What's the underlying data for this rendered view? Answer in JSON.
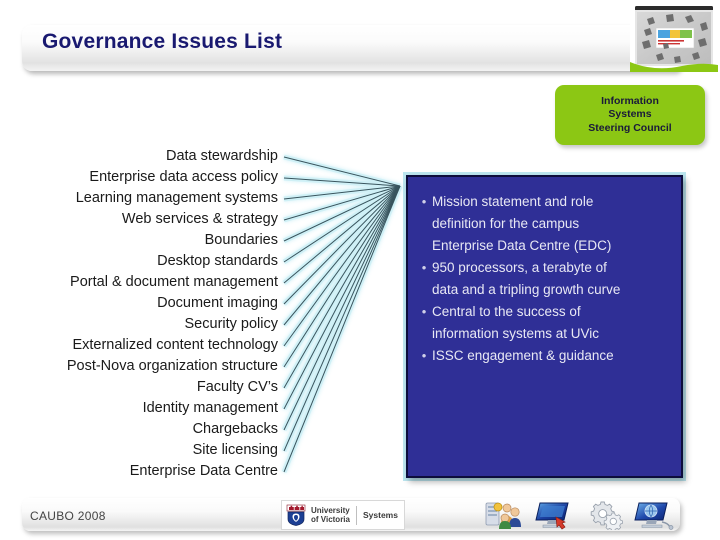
{
  "slide": {
    "title": "Governance Issues List",
    "accent_blue": "#191970",
    "accent_green": "#8cc714",
    "box_blue": "#2f2f96"
  },
  "green_label": {
    "text": "Information\nSystems\nSteering Council",
    "name": "information-systems-steering-council"
  },
  "issues": {
    "items": [
      "Data stewardship",
      "Enterprise data access policy",
      "Learning management systems",
      "Web services & strategy",
      "Boundaries",
      "Desktop standards",
      "Portal & document management",
      "Document imaging",
      "Security policy",
      "Externalized content technology",
      "Post-Nova organization structure",
      "Faculty CV’s",
      "Identity management",
      "Chargebacks",
      "Site licensing",
      "Enterprise Data Centre"
    ]
  },
  "detail_box": {
    "bullets": [
      {
        "marker": "•",
        "text": "Mission statement and role\ndefinition for the campus\nEnterprise Data Centre (EDC)"
      },
      {
        "marker": "•",
        "text": "950 processors, a terabyte of\ndata and a tripling growth curve"
      },
      {
        "marker": "•",
        "text": "Central to the success of\ninformation systems at UVic"
      },
      {
        "marker": "•",
        "text": "ISSC engagement & guidance"
      }
    ]
  },
  "footer": {
    "conference": "CAUBO 2008",
    "university": "University\nof Victoria",
    "unit": "Systems",
    "icons": [
      "users-and-server-icon",
      "monitor-with-arrow-icon",
      "gears-icon",
      "monitor-with-globe-icon"
    ]
  },
  "decor": {
    "projector_image": "projector-screen-photo",
    "fan_lines": "fan-connector-lines"
  }
}
